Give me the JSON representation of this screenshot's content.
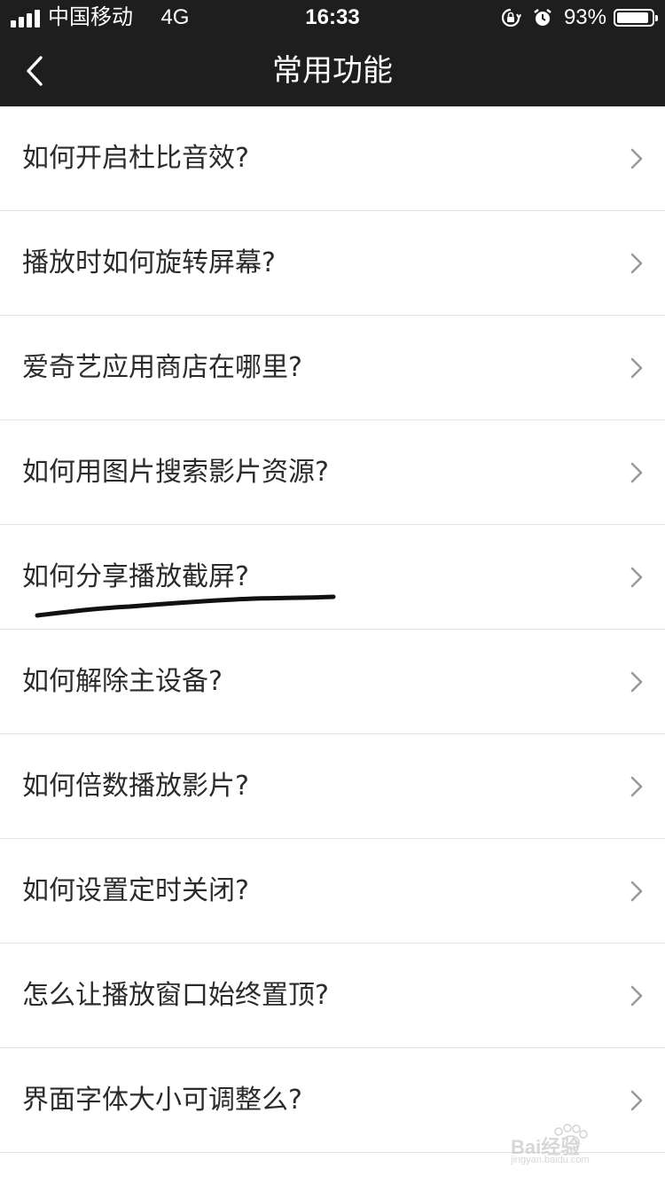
{
  "status_bar": {
    "carrier": "中国移动",
    "network": "4G",
    "time": "16:33",
    "battery_percent": "93%",
    "battery_level": 0.93
  },
  "nav": {
    "title": "常用功能",
    "back_icon": "chevron-left-icon"
  },
  "faq": {
    "items": [
      {
        "label": "如何开启杜比音效?"
      },
      {
        "label": "播放时如何旋转屏幕?"
      },
      {
        "label": "爱奇艺应用商店在哪里?"
      },
      {
        "label": "如何用图片搜索影片资源?"
      },
      {
        "label": "如何分享播放截屏?"
      },
      {
        "label": "如何解除主设备?"
      },
      {
        "label": "如何倍数播放影片?"
      },
      {
        "label": "如何设置定时关闭?"
      },
      {
        "label": "怎么让播放窗口始终置顶?"
      },
      {
        "label": "界面字体大小可调整么?"
      }
    ],
    "chevron_icon": "chevron-right-icon"
  },
  "watermark": {
    "logo_text": "Bai经验",
    "url": "jingyan.baidu.com"
  },
  "colors": {
    "header_bg": "#1e1e1e",
    "text": "#2b2b2b",
    "divider": "#e3e3e3",
    "chevron": "#9a9a9a"
  }
}
